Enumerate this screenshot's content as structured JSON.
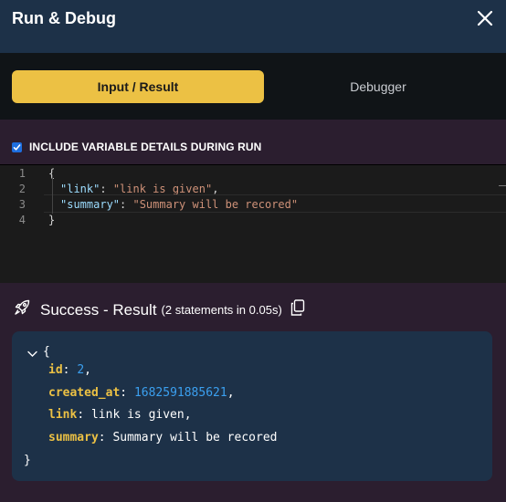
{
  "header": {
    "title": "Run & Debug"
  },
  "tabs": [
    {
      "label": "Input / Result",
      "active": true
    },
    {
      "label": "Debugger",
      "active": false
    }
  ],
  "option": {
    "label": "INCLUDE VARIABLE DETAILS DURING RUN",
    "checked": true
  },
  "editor": {
    "line_numbers": [
      "1",
      "2",
      "3",
      "4"
    ],
    "open_brace": "{",
    "close_brace": "}",
    "line2": {
      "key": "\"link\"",
      "sep": ": ",
      "value": "\"link is given\"",
      "trail": ","
    },
    "line3": {
      "key": "\"summary\"",
      "sep": ": ",
      "value": "\"Summary will be recored\""
    }
  },
  "result": {
    "title": "Success - Result",
    "meta": "(2 statements in 0.05s)",
    "open_brace": "{",
    "close_brace": "}",
    "fields": [
      {
        "key": "id",
        "value": "2",
        "type": "number",
        "trail": ","
      },
      {
        "key": "created_at",
        "value": "1682591885621",
        "type": "number",
        "trail": ","
      },
      {
        "key": "link",
        "value": "link is given",
        "type": "string",
        "trail": ","
      },
      {
        "key": "summary",
        "value": "Summary will be recored",
        "type": "string",
        "trail": ""
      }
    ]
  },
  "colors": {
    "accent": "#ecc144",
    "header_bg": "#1d3148",
    "number": "#3ba0f0",
    "checkbox": "#1e6fe0"
  }
}
